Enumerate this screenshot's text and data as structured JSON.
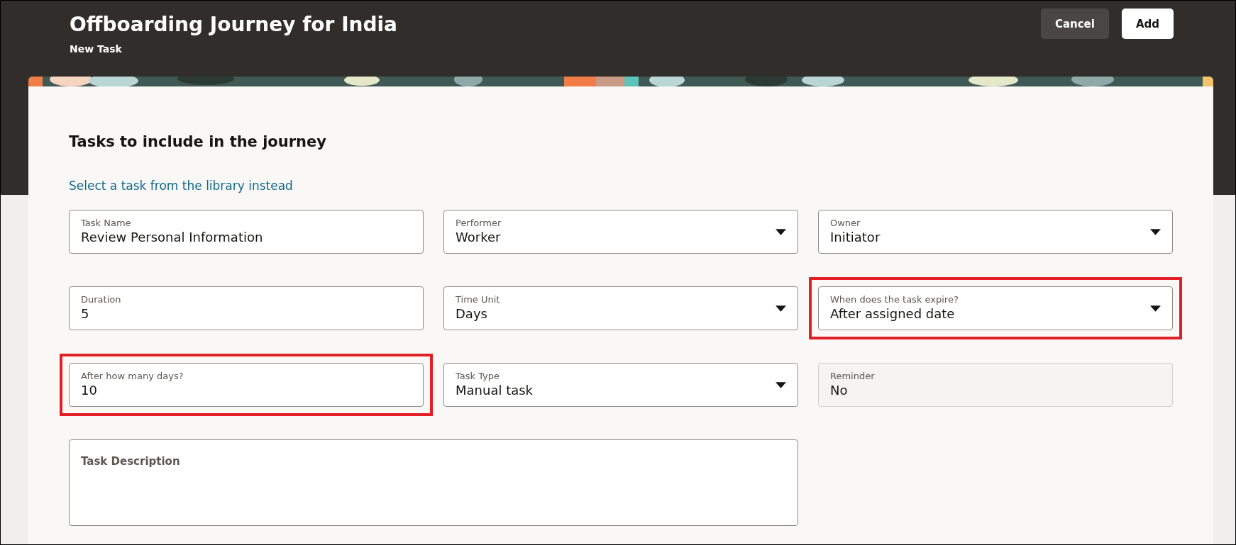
{
  "header": {
    "title": "Offboarding Journey for India",
    "subtitle": "New Task",
    "buttons": [
      {
        "label": "Cancel",
        "kind": "secondary"
      },
      {
        "label": "Add",
        "kind": "primary"
      }
    ]
  },
  "section": {
    "heading": "Tasks to include in the journey",
    "link": "Select a task from the library instead"
  },
  "fields": [
    {
      "label": "Task Name",
      "value": "Review Personal Information",
      "kind": "text",
      "highlighted": false
    },
    {
      "label": "Performer",
      "value": "Worker",
      "kind": "select",
      "highlighted": false
    },
    {
      "label": "Owner",
      "value": "Initiator",
      "kind": "select",
      "highlighted": false
    },
    {
      "label": "Duration",
      "value": "5",
      "kind": "text",
      "highlighted": false
    },
    {
      "label": "Time Unit",
      "value": "Days",
      "kind": "select",
      "highlighted": false
    },
    {
      "label": "When does the task expire?",
      "value": "After assigned date",
      "kind": "select",
      "highlighted": true
    },
    {
      "label": "After how many days?",
      "value": "10",
      "kind": "text",
      "highlighted": true
    },
    {
      "label": "Task Type",
      "value": "Manual task",
      "kind": "select",
      "highlighted": false
    },
    {
      "label": "Reminder",
      "value": "No",
      "kind": "readonly",
      "highlighted": false
    },
    {
      "label": "Task Description",
      "kind": "textarea",
      "highlighted": false
    }
  ]
}
